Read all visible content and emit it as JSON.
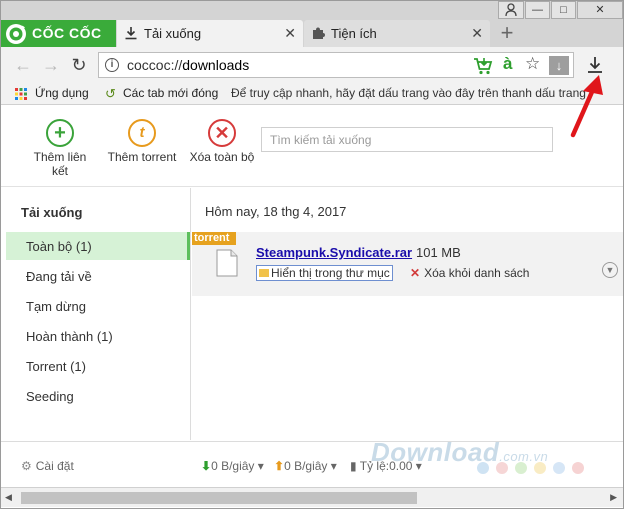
{
  "brand": {
    "name": "CỐC CỐC"
  },
  "tabs": [
    {
      "label": "Tải xuống",
      "icon": "download-icon",
      "active": true
    },
    {
      "label": "Tiện ích",
      "icon": "puzzle-icon",
      "active": false
    }
  ],
  "window_controls": {
    "minimize": "—",
    "maximize": "□",
    "close": "✕"
  },
  "toolbar": {
    "url_scheme": "coccoc://",
    "url_path": "downloads",
    "icons": [
      "back-icon",
      "forward-icon",
      "reload-icon",
      "info-icon",
      "cart-icon",
      "translate-icon",
      "star-icon",
      "download-icon"
    ]
  },
  "bookmarks": {
    "apps_label": "Ứng dụng",
    "new_tabs_label": "Các tab mới đóng",
    "hint": "Để truy cập nhanh, hãy đặt dấu trang vào đây trên thanh dấu trang"
  },
  "actions": {
    "add_link_label": "Thêm liên kết",
    "add_torrent_label": "Thêm torrent",
    "clear_all_label": "Xóa toàn bộ",
    "search_placeholder": "Tìm kiếm tải xuống"
  },
  "sidebar": {
    "title": "Tải xuống",
    "items": [
      {
        "label": "Toàn bộ (1)",
        "active": true
      },
      {
        "label": "Đang tải về",
        "active": false
      },
      {
        "label": "Tạm dừng",
        "active": false
      },
      {
        "label": "Hoàn thành (1)",
        "active": false
      },
      {
        "label": "Torrent (1)",
        "active": false
      },
      {
        "label": "Seeding",
        "active": false
      }
    ]
  },
  "downloads": {
    "date_heading": "Hôm nay, 18 thg 4, 2017",
    "items": [
      {
        "tag": "torrent",
        "file_name": "Steampunk.Syndicate.rar",
        "size": "101 MB",
        "show_in_folder_label": "Hiển thị trong thư mục",
        "remove_label": "Xóa khỏi danh sách"
      }
    ]
  },
  "footer": {
    "settings_label": "Cài đặt",
    "down_speed": "0 B/giây",
    "up_speed": "0 B/giây",
    "ratio": "Tỷ lệ:0.00"
  },
  "watermark": {
    "main": "Download",
    "suffix": ".com.vn"
  },
  "colors": {
    "brand_green": "#3aab3a",
    "torrent_orange": "#e6a21f",
    "active_item_bg": "#d6f2d6",
    "link_blue": "#1a0dab",
    "delete_red": "#d63b3b",
    "annotation_red": "#e0161b"
  }
}
